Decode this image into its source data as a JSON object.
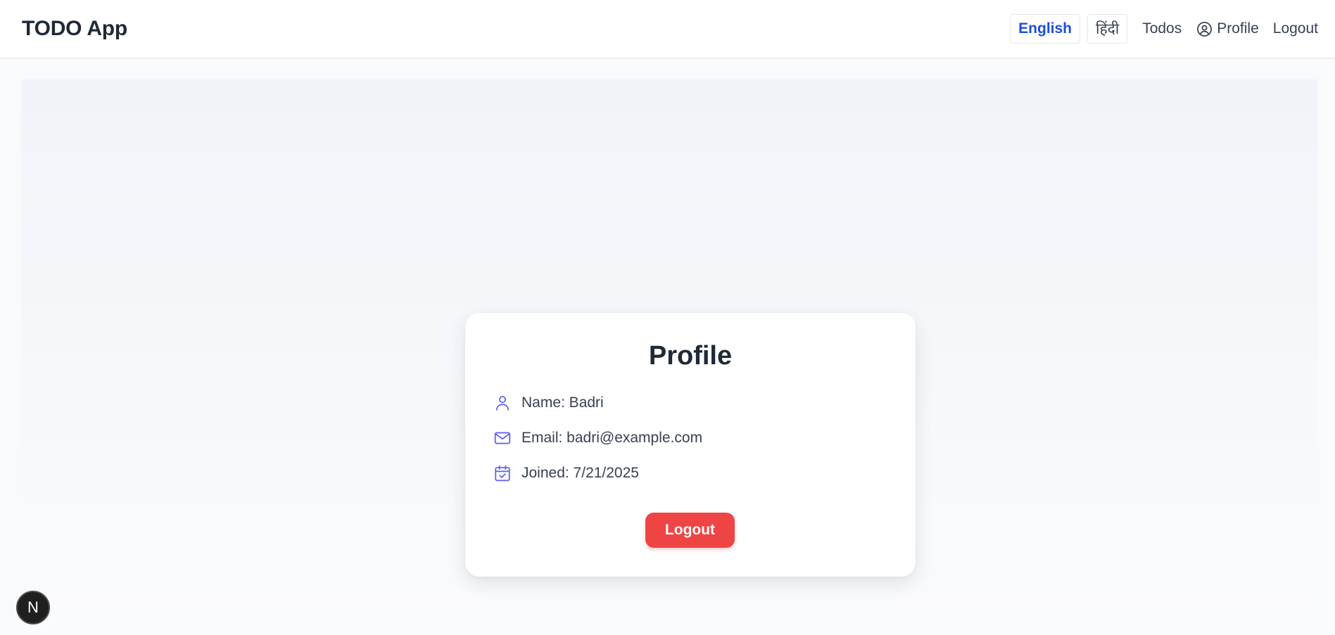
{
  "header": {
    "brand": "TODO App",
    "languages": [
      {
        "label": "English",
        "active": true
      },
      {
        "label": "हिंदी",
        "active": false
      }
    ],
    "nav": {
      "todos": "Todos",
      "profile": "Profile",
      "logout": "Logout"
    }
  },
  "profile_card": {
    "title": "Profile",
    "name": "Name: Badri",
    "email": "Email: badri@example.com",
    "joined": "Joined: 7/21/2025",
    "logout_label": "Logout"
  },
  "dev_badge": {
    "letter": "N"
  },
  "colors": {
    "accent": "#1d4ed8",
    "danger": "#ef4444",
    "icon": "#6366f1"
  },
  "icons": {
    "profile": "user-circle-icon",
    "name": "user-icon",
    "email": "mail-icon",
    "joined": "calendar-check-icon"
  }
}
